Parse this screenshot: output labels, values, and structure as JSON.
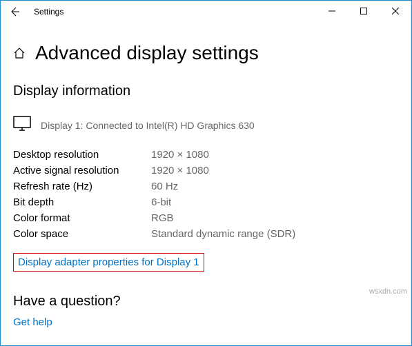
{
  "titlebar": {
    "app_name": "Settings"
  },
  "header": {
    "title": "Advanced display settings"
  },
  "display_info": {
    "section_title": "Display information",
    "connection_text": "Display 1: Connected to Intel(R) HD Graphics 630",
    "rows": [
      {
        "label": "Desktop resolution",
        "value": "1920 × 1080"
      },
      {
        "label": "Active signal resolution",
        "value": "1920 × 1080"
      },
      {
        "label": "Refresh rate (Hz)",
        "value": "60 Hz"
      },
      {
        "label": "Bit depth",
        "value": "6-bit"
      },
      {
        "label": "Color format",
        "value": "RGB"
      },
      {
        "label": "Color space",
        "value": "Standard dynamic range (SDR)"
      }
    ],
    "adapter_link": "Display adapter properties for Display 1"
  },
  "question": {
    "title": "Have a question?",
    "help_link": "Get help"
  },
  "watermark": "wsxdn.com"
}
